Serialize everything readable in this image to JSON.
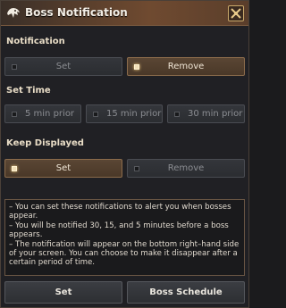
{
  "window": {
    "title": "Boss Notification"
  },
  "notification": {
    "label": "Notification",
    "options": [
      {
        "label": "Set",
        "selected": false
      },
      {
        "label": "Remove",
        "selected": true
      }
    ]
  },
  "set_time": {
    "label": "Set Time",
    "options": [
      {
        "label": "5 min prior",
        "selected": false
      },
      {
        "label": "15 min prior",
        "selected": false
      },
      {
        "label": "30 min prior",
        "selected": false
      }
    ]
  },
  "keep_displayed": {
    "label": "Keep Displayed",
    "options": [
      {
        "label": "Set",
        "selected": true
      },
      {
        "label": "Remove",
        "selected": false
      }
    ]
  },
  "info": {
    "lines": [
      "– You can set these notifications to alert you when bosses appear.",
      "– You will be notified 30, 15, and 5 minutes before a boss appears.",
      "– The notification will appear on the bottom right–hand side of your screen. You can choose to make it disappear after a certain period of time."
    ]
  },
  "buttons": {
    "set": "Set",
    "schedule": "Boss Schedule"
  },
  "colors": {
    "accent": "#8c6c4c",
    "active_bg": "#4a3828",
    "inactive_bg": "#2b2d31"
  },
  "icons": {
    "title": "boss-emblem-icon",
    "close": "close-icon"
  }
}
